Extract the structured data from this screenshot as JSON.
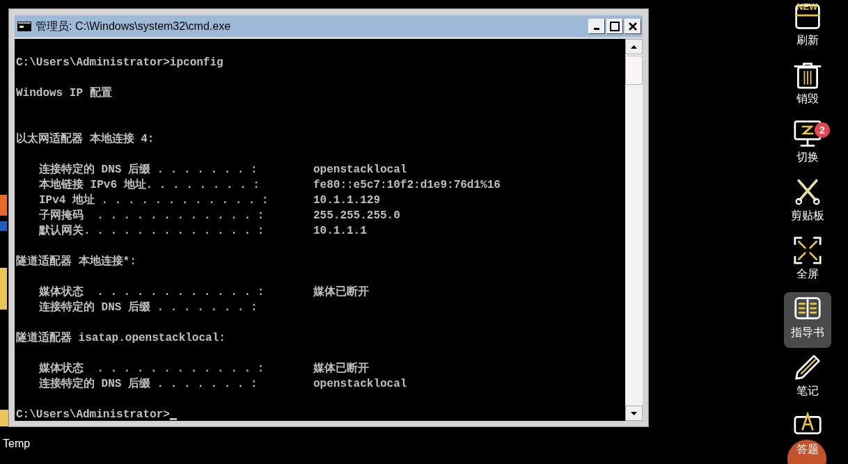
{
  "window": {
    "title": "管理员: C:\\Windows\\system32\\cmd.exe",
    "controls": [
      {
        "kind": "minimize"
      },
      {
        "kind": "maximize"
      },
      {
        "kind": "close"
      }
    ]
  },
  "console": {
    "lines": [
      {
        "kind": "blank"
      },
      {
        "kind": "text",
        "text": "C:\\Users\\Administrator>ipconfig"
      },
      {
        "kind": "blank"
      },
      {
        "kind": "text",
        "text": "Windows IP 配置"
      },
      {
        "kind": "blank"
      },
      {
        "kind": "blank"
      },
      {
        "kind": "text",
        "text": "以太网适配器 本地连接 4:"
      },
      {
        "kind": "blank"
      },
      {
        "kind": "entry",
        "label": "连接特定的 DNS 后缀 . . . . . . . :",
        "value": "openstacklocal"
      },
      {
        "kind": "entry",
        "label": "本地链接 IPv6 地址. . . . . . . . :",
        "value": "fe80::e5c7:10f2:d1e9:76d1%16"
      },
      {
        "kind": "entry",
        "label": "IPv4 地址 . . . . . . . . . . . . :",
        "value": "10.1.1.129"
      },
      {
        "kind": "entry",
        "label": "子网掩码  . . . . . . . . . . . . :",
        "value": "255.255.255.0"
      },
      {
        "kind": "entry",
        "label": "默认网关. . . . . . . . . . . . . :",
        "value": "10.1.1.1"
      },
      {
        "kind": "blank"
      },
      {
        "kind": "text",
        "text": "隧道适配器 本地连接*:"
      },
      {
        "kind": "blank"
      },
      {
        "kind": "entry",
        "label": "媒体状态  . . . . . . . . . . . . :",
        "value": "媒体已断开"
      },
      {
        "kind": "entry",
        "label": "连接特定的 DNS 后缀 . . . . . . . :"
      },
      {
        "kind": "blank"
      },
      {
        "kind": "text",
        "text": "隧道适配器 isatap.openstacklocal:"
      },
      {
        "kind": "blank"
      },
      {
        "kind": "entry",
        "label": "媒体状态  . . . . . . . . . . . . :",
        "value": "媒体已断开"
      },
      {
        "kind": "entry",
        "label": "连接特定的 DNS 后缀 . . . . . . . :",
        "value": "openstacklocal"
      },
      {
        "kind": "blank"
      },
      {
        "kind": "prompt",
        "text": "C:\\Users\\Administrator>"
      }
    ]
  },
  "desktop": {
    "icons": [
      {
        "label": "Temp"
      }
    ]
  },
  "toolbar": {
    "items": [
      {
        "kind": "refresh",
        "label": "刷新",
        "tag": "NEW",
        "selected": false
      },
      {
        "kind": "trash",
        "label": "销毁",
        "selected": false
      },
      {
        "kind": "switch",
        "label": "切换",
        "badge": "2",
        "selected": false
      },
      {
        "kind": "scissors",
        "label": "剪贴板",
        "selected": false
      },
      {
        "kind": "fullscreen",
        "label": "全屏",
        "selected": false
      },
      {
        "kind": "book",
        "label": "指导书",
        "selected": true
      },
      {
        "kind": "pen",
        "label": "笔记",
        "selected": false
      },
      {
        "kind": "answer",
        "label": "答题",
        "selected": false
      }
    ]
  }
}
